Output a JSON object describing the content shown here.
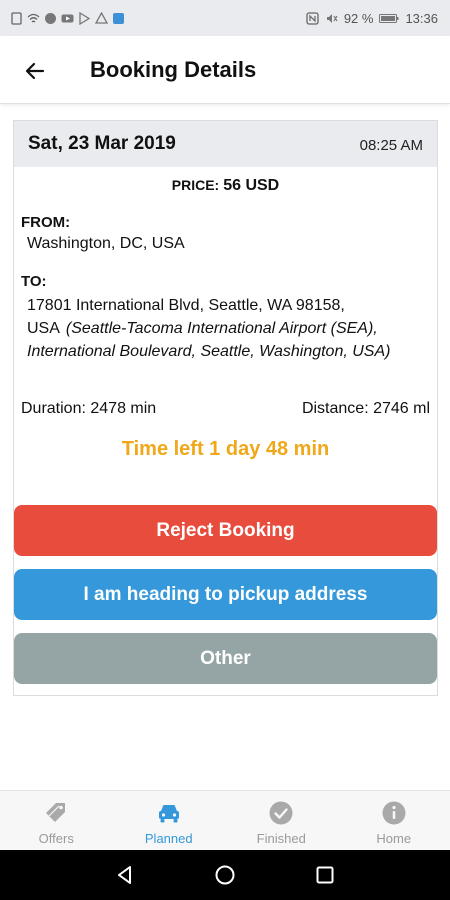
{
  "status_bar": {
    "battery": "92 %",
    "time": "13:36"
  },
  "app_bar": {
    "title": "Booking Details"
  },
  "booking": {
    "date": "Sat, 23 Mar 2019",
    "time": "08:25 AM",
    "price_label": "PRICE:",
    "price_value": "56 USD",
    "from_label": "FROM:",
    "from_value": "Washington, DC, USA",
    "to_label": "TO:",
    "to_value": "17801 International Blvd, Seattle, WA 98158, USA",
    "to_extra": "(Seattle-Tacoma International Airport (SEA), International Boulevard, Seattle, Washington, USA)",
    "duration": "Duration: 2478 min",
    "distance": "Distance: 2746 ml",
    "time_left": "Time left 1 day 48 min"
  },
  "actions": {
    "reject_label": "Reject Booking",
    "heading_label": "I am heading to pickup address",
    "other_label": "Other"
  },
  "colors": {
    "reject": "#e74c3c",
    "heading": "#3498db",
    "other": "#95a5a6",
    "time_left": "#f0a81a",
    "active_tab": "#3498db"
  },
  "bottom_nav": {
    "items": [
      {
        "label": "Offers",
        "icon": "tag-icon",
        "active": false
      },
      {
        "label": "Planned",
        "icon": "car-icon",
        "active": true
      },
      {
        "label": "Finished",
        "icon": "check-circle-icon",
        "active": false
      },
      {
        "label": "Home",
        "icon": "info-icon",
        "active": false
      }
    ]
  }
}
